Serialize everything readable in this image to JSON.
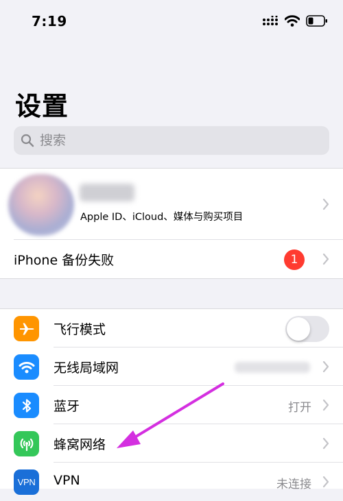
{
  "status_bar": {
    "time": "7:19"
  },
  "page": {
    "title": "设置"
  },
  "search": {
    "placeholder": "搜索"
  },
  "profile": {
    "name": "",
    "subtitle": "Apple ID、iCloud、媒体与购买项目"
  },
  "backup": {
    "label": "iPhone 备份失败",
    "badge": "1"
  },
  "settings": {
    "airplane": {
      "label": "飞行模式",
      "toggle_on": false,
      "color": "#ff9500"
    },
    "wifi": {
      "label": "无线局域网",
      "value": "",
      "color": "#1a8cff"
    },
    "bluetooth": {
      "label": "蓝牙",
      "value": "打开",
      "color": "#1a8cff"
    },
    "cellular": {
      "label": "蜂窝网络",
      "color": "#34c759"
    },
    "vpn": {
      "label": "VPN",
      "value": "未连接",
      "icon_text": "VPN",
      "color": "#1a6fd8"
    }
  },
  "colors": {
    "annotation": "#d42fe0",
    "badge": "#ff3b30"
  }
}
